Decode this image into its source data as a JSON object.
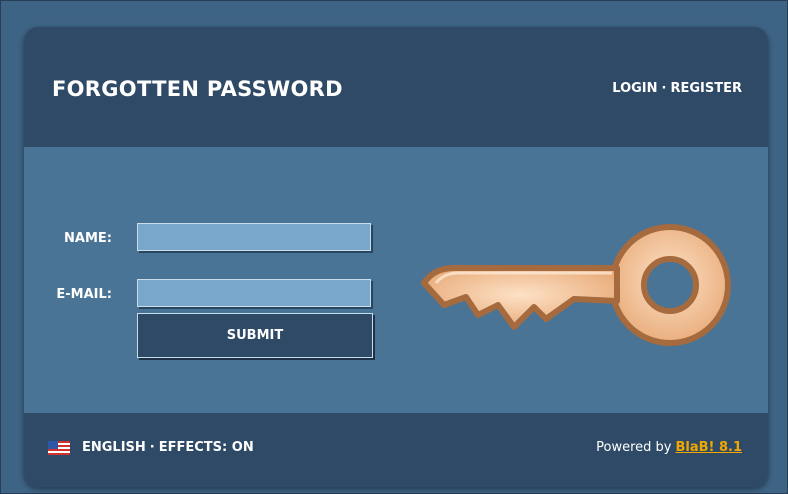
{
  "header": {
    "title": "FORGOTTEN PASSWORD",
    "links": {
      "login": "LOGIN",
      "register": "REGISTER",
      "separator": "·"
    }
  },
  "form": {
    "name_label": "NAME:",
    "name_value": "",
    "email_label": "E-MAIL:",
    "email_value": "",
    "submit_label": "SUBMIT"
  },
  "footer": {
    "language": "ENGLISH",
    "separator": "·",
    "effects": "EFFECTS: ON",
    "powered_prefix": "Powered by",
    "powered_link": "BlaB! 8.1"
  },
  "icons": {
    "key": "key-icon",
    "flag": "us-flag-icon"
  },
  "colors": {
    "header_bg": "#2f4a66",
    "body_bg": "#4a7496",
    "input_bg": "#7aa8cc",
    "link_accent": "#f0a800",
    "key_fill": "#f3c7a0",
    "key_outline": "#a56a3d"
  }
}
